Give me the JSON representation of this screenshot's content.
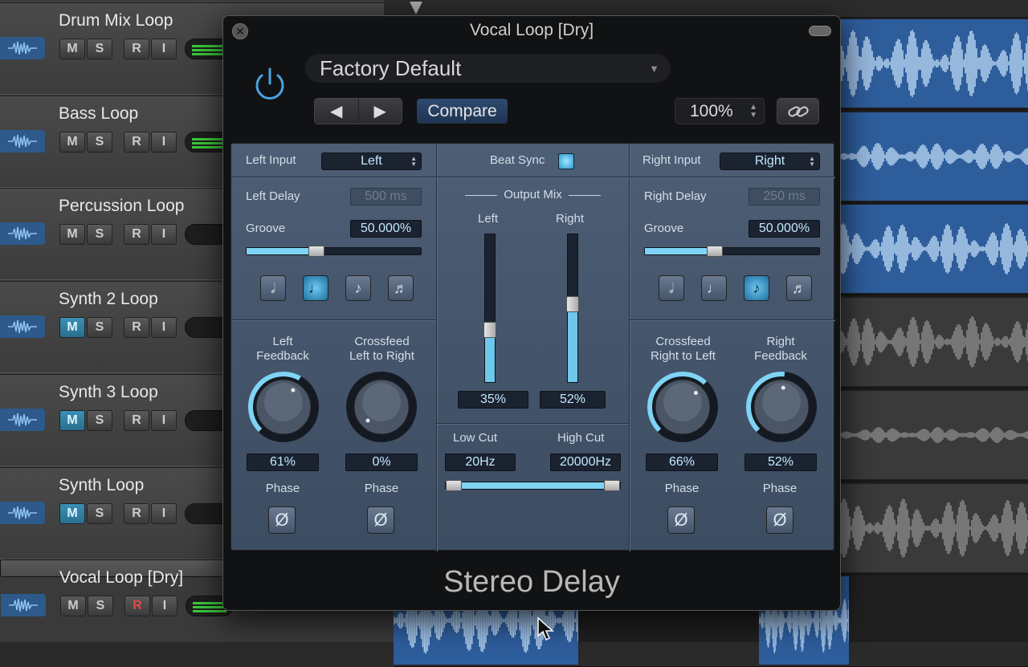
{
  "tracks": [
    {
      "name": "Drum Mix Loop",
      "mute": false,
      "rec": false,
      "meter": true
    },
    {
      "name": "Bass Loop",
      "mute": false,
      "rec": false,
      "meter": true
    },
    {
      "name": "Percussion Loop",
      "mute": false,
      "rec": false,
      "meter": false
    },
    {
      "name": "Synth 2 Loop",
      "mute": true,
      "rec": false,
      "meter": false
    },
    {
      "name": "Synth 3 Loop",
      "mute": true,
      "rec": false,
      "meter": false
    },
    {
      "name": "Synth Loop",
      "mute": true,
      "rec": false,
      "meter": false
    },
    {
      "name": "Vocal Loop [Dry]",
      "mute": false,
      "rec": true,
      "meter": true
    }
  ],
  "track_buttons": {
    "m": "M",
    "s": "S",
    "r": "R",
    "i": "I"
  },
  "window": {
    "title": "Vocal Loop [Dry]",
    "preset": "Factory Default",
    "prev": "◀",
    "next": "▶",
    "compare": "Compare",
    "zoom": "100%",
    "plugin_name": "Stereo Delay"
  },
  "left": {
    "input_label": "Left Input",
    "input_value": "Left",
    "delay_label": "Left Delay",
    "delay_value": "500 ms",
    "groove_label": "Groove",
    "groove_value": "50.000%",
    "groove": 0.5,
    "active_note": 2,
    "feedback_label_1": "Left",
    "feedback_label_2": "Feedback",
    "feedback_value": "61%",
    "feedback": 0.61,
    "crossfeed_label_1": "Crossfeed",
    "crossfeed_label_2": "Left to Right",
    "crossfeed_value": "0%",
    "crossfeed": 0.0,
    "phase_label": "Phase"
  },
  "center": {
    "beat_sync_label": "Beat Sync",
    "beat_sync": true,
    "output_mix_label": "Output Mix",
    "left_label": "Left",
    "right_label": "Right",
    "left_mix_value": "35%",
    "left_mix": 0.35,
    "right_mix_value": "52%",
    "right_mix": 0.52,
    "low_cut_label": "Low Cut",
    "high_cut_label": "High Cut",
    "low_cut_value": "20Hz",
    "high_cut_value": "20000Hz"
  },
  "right": {
    "input_label": "Right Input",
    "input_value": "Right",
    "delay_label": "Right Delay",
    "delay_value": "250 ms",
    "groove_label": "Groove",
    "groove_value": "50.000%",
    "groove": 0.5,
    "active_note": 3,
    "crossfeed_label_1": "Crossfeed",
    "crossfeed_label_2": "Right to Left",
    "crossfeed_value": "66%",
    "crossfeed": 0.66,
    "feedback_label_1": "Right",
    "feedback_label_2": "Feedback",
    "feedback_value": "52%",
    "feedback": 0.52,
    "phase_label": "Phase"
  },
  "phase_symbol": "Ø",
  "colors": {
    "accent": "#6fc7ec",
    "panel": "#4a5b72",
    "region_blue": "#2e5d9c"
  }
}
